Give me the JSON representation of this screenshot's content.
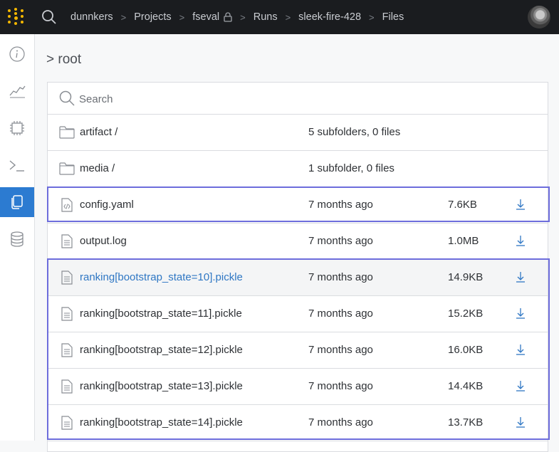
{
  "topbar": {
    "breadcrumbs": [
      "dunnkers",
      "Projects",
      "fseval",
      "Runs",
      "sleek-fire-428",
      "Files"
    ],
    "separator": ">",
    "icons": {
      "logo": "wandb-logo-icon",
      "search": "search-icon",
      "lock": "lock-icon",
      "avatar": "user-avatar"
    }
  },
  "sidebar": {
    "items": [
      {
        "icon": "info-icon",
        "active": false
      },
      {
        "icon": "chart-line-icon",
        "active": false
      },
      {
        "icon": "chip-icon",
        "active": false
      },
      {
        "icon": "terminal-icon",
        "active": false
      },
      {
        "icon": "files-icon",
        "active": true
      },
      {
        "icon": "database-icon",
        "active": false
      }
    ],
    "active_color": "#2c7bd1"
  },
  "main": {
    "path_title": "> root",
    "search": {
      "placeholder": "Search",
      "value": ""
    },
    "rows": [
      {
        "type": "folder",
        "name": "artifact /",
        "info": "5 subfolders, 0 files",
        "size": "",
        "download": false
      },
      {
        "type": "folder",
        "name": "media /",
        "info": "1 subfolder, 0 files",
        "size": "",
        "download": false
      },
      {
        "type": "code",
        "name": "config.yaml",
        "info": "7 months ago",
        "size": "7.6KB",
        "download": true
      },
      {
        "type": "file",
        "name": "output.log",
        "info": "7 months ago",
        "size": "1.0MB",
        "download": true
      },
      {
        "type": "file",
        "name": "ranking[bootstrap_state=10].pickle",
        "info": "7 months ago",
        "size": "14.9KB",
        "download": true
      },
      {
        "type": "file",
        "name": "ranking[bootstrap_state=11].pickle",
        "info": "7 months ago",
        "size": "15.2KB",
        "download": true
      },
      {
        "type": "file",
        "name": "ranking[bootstrap_state=12].pickle",
        "info": "7 months ago",
        "size": "16.0KB",
        "download": true
      },
      {
        "type": "file",
        "name": "ranking[bootstrap_state=13].pickle",
        "info": "7 months ago",
        "size": "14.4KB",
        "download": true
      },
      {
        "type": "file",
        "name": "ranking[bootstrap_state=14].pickle",
        "info": "7 months ago",
        "size": "13.7KB",
        "download": true
      }
    ]
  },
  "colors": {
    "topbar": "#1a1c1f",
    "accent": "#2c7bd1",
    "highlight": "#6d6ddc",
    "link": "#2f77c4",
    "logo": "#f5b700"
  }
}
